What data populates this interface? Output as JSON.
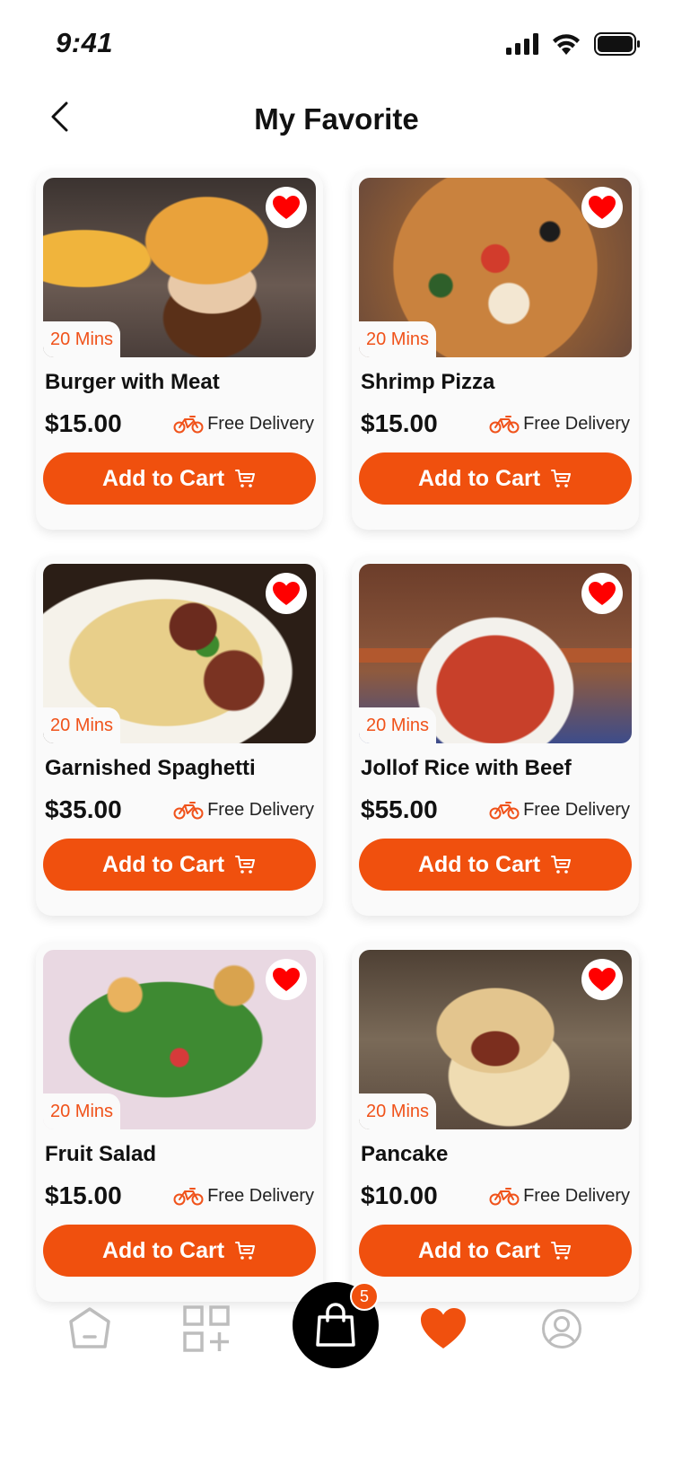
{
  "status_bar": {
    "time": "9:41"
  },
  "header": {
    "title": "My Favorite"
  },
  "items": [
    {
      "name": "Burger with Meat",
      "price": "$15.00",
      "time": "20 Mins",
      "delivery": "Free Delivery",
      "cta": "Add to Cart",
      "favorited": true
    },
    {
      "name": "Shrimp Pizza",
      "price": "$15.00",
      "time": "20 Mins",
      "delivery": "Free Delivery",
      "cta": "Add to Cart",
      "favorited": true
    },
    {
      "name": "Garnished Spaghetti",
      "price": "$35.00",
      "time": "20 Mins",
      "delivery": "Free Delivery",
      "cta": "Add to Cart",
      "favorited": true
    },
    {
      "name": "Jollof Rice with Beef",
      "price": "$55.00",
      "time": "20 Mins",
      "delivery": "Free Delivery",
      "cta": "Add to Cart",
      "favorited": true
    },
    {
      "name": "Fruit Salad",
      "price": "$15.00",
      "time": "20 Mins",
      "delivery": "Free Delivery",
      "cta": "Add to Cart",
      "favorited": true
    },
    {
      "name": "Pancake",
      "price": "$10.00",
      "time": "20 Mins",
      "delivery": "Free Delivery",
      "cta": "Add to Cart",
      "favorited": true
    }
  ],
  "bottom_nav": {
    "cart_badge": "5",
    "items": [
      {
        "icon": "home-icon",
        "active": false
      },
      {
        "icon": "categories-icon",
        "active": false
      },
      {
        "icon": "shopping-bag-icon",
        "active": false
      },
      {
        "icon": "heart-icon",
        "active": true
      },
      {
        "icon": "profile-icon",
        "active": false
      }
    ]
  },
  "colors": {
    "accent": "#f0500e",
    "heart": "#ff0000",
    "card_bg": "#fafafa",
    "inactive_icon": "#bdbdbd"
  }
}
